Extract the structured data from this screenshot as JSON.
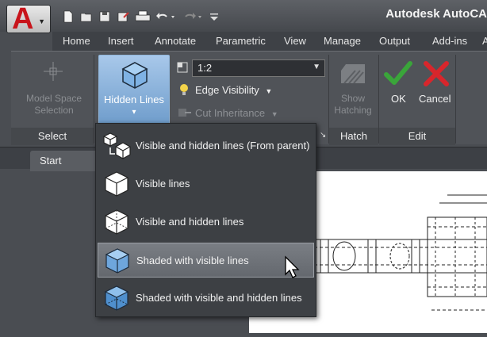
{
  "titlebar": {
    "app_title": "Autodesk AutoCA",
    "app_logo": "A"
  },
  "quick_access": [
    "new-icon",
    "open-icon",
    "save-icon",
    "save-as-icon",
    "plot-icon",
    "undo-icon",
    "redo-icon",
    "customize-icon"
  ],
  "tabs": [
    {
      "label": "Home"
    },
    {
      "label": "Insert"
    },
    {
      "label": "Annotate"
    },
    {
      "label": "Parametric"
    },
    {
      "label": "View"
    },
    {
      "label": "Manage"
    },
    {
      "label": "Output"
    },
    {
      "label": "Add-ins"
    },
    {
      "label": "A"
    }
  ],
  "ribbon": {
    "select_panel": {
      "tool_line1": "Model Space",
      "tool_line2": "Selection",
      "footer": "Select"
    },
    "hidden_lines": {
      "label": "Hidden Lines",
      "arrow": "▾"
    },
    "scale": {
      "value": "1:2"
    },
    "edge_visibility": "Edge Visibility",
    "cut_inheritance": "Cut Inheritance",
    "hatch_panel": {
      "line1": "Show",
      "line2": "Hatching",
      "footer": "Hatch"
    },
    "edit_panel": {
      "ok": "OK",
      "cancel": "Cancel",
      "footer": "Edit"
    }
  },
  "start_tab": "Start",
  "dropdown": {
    "items": [
      {
        "label": "Visible and hidden lines (From parent)"
      },
      {
        "label": "Visible lines"
      },
      {
        "label": "Visible and hidden lines"
      },
      {
        "label": "Shaded with visible lines"
      },
      {
        "label": "Shaded with visible and hidden lines"
      }
    ],
    "highlighted_index": 3
  },
  "colors": {
    "accent_blue": "#7ea8d6",
    "ok_green": "#3aa53a",
    "cancel_red": "#d8262c",
    "logo_red": "#c8141b"
  }
}
